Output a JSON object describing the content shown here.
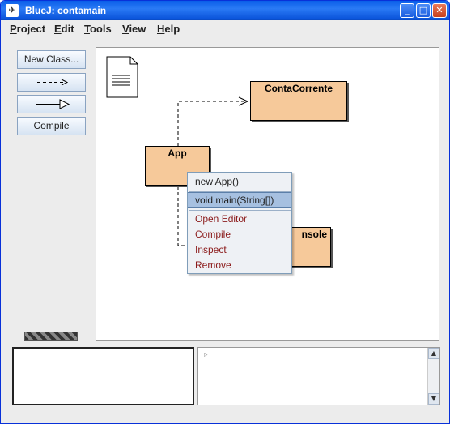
{
  "window": {
    "title": "BlueJ:  contamain",
    "icon": "bluej-bird-icon",
    "controls": {
      "minimize": "_",
      "maximize": "□",
      "close": "✕"
    }
  },
  "menubar": {
    "items": [
      {
        "label": "Project",
        "mnemonic": "P",
        "rest": "roject"
      },
      {
        "label": "Edit",
        "mnemonic": "E",
        "rest": "dit"
      },
      {
        "label": "Tools",
        "mnemonic": "T",
        "rest": "ools"
      },
      {
        "label": "View",
        "mnemonic": "V",
        "rest": "iew"
      },
      {
        "label": "Help",
        "mnemonic": "H",
        "rest": "elp"
      }
    ]
  },
  "toolbar": {
    "new_class_label": "New Class...",
    "uses_arrow_icon": "dashed-arrow-icon",
    "inherit_arrow_icon": "inheritance-arrow-icon",
    "compile_label": "Compile"
  },
  "diagram": {
    "classes": [
      {
        "name": "ContaCorrente"
      },
      {
        "name": "App"
      },
      {
        "name": "Console",
        "visible_text": "nsole"
      }
    ],
    "readme_icon": "readme-document-icon"
  },
  "context_menu": {
    "items": [
      {
        "label": "new App()",
        "style": "normal"
      },
      {
        "label": "void main(String[])",
        "style": "selected"
      },
      {
        "label": "Open Editor",
        "style": "action"
      },
      {
        "label": "Compile",
        "style": "action"
      },
      {
        "label": "Inspect",
        "style": "action"
      },
      {
        "label": "Remove",
        "style": "action"
      }
    ]
  },
  "codepad": {
    "marker": "▹"
  },
  "colors": {
    "title_bar": "#0a5ee8",
    "class_fill": "#f6c99a",
    "menu_selected": "#a6c0e0",
    "menu_action_text": "#8b1a1a"
  }
}
